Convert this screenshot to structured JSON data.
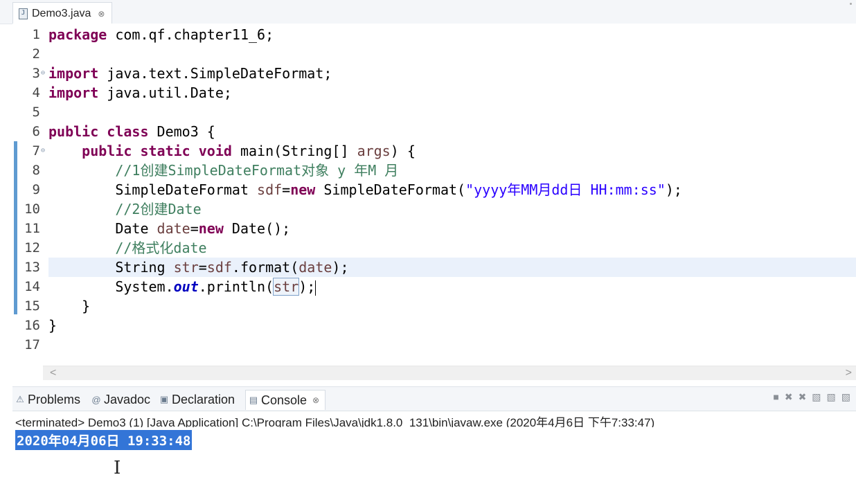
{
  "editor": {
    "tab_label": "Demo3.java",
    "tab_close": "⊗",
    "file_icon": "J",
    "lines": [
      {
        "n": "1",
        "fold": "",
        "tokens": [
          {
            "t": "package",
            "c": "kw"
          },
          {
            "t": " com.qf.chapter11_6;",
            "c": ""
          }
        ]
      },
      {
        "n": "2",
        "fold": "",
        "tokens": []
      },
      {
        "n": "3",
        "fold": "⊖",
        "tokens": [
          {
            "t": "import",
            "c": "kw"
          },
          {
            "t": " java.text.SimpleDateFormat;",
            "c": ""
          }
        ]
      },
      {
        "n": "4",
        "fold": "",
        "tokens": [
          {
            "t": "import",
            "c": "kw"
          },
          {
            "t": " java.util.Date;",
            "c": ""
          }
        ]
      },
      {
        "n": "5",
        "fold": "",
        "tokens": []
      },
      {
        "n": "6",
        "fold": "",
        "tokens": [
          {
            "t": "public",
            "c": "kw"
          },
          {
            "t": " ",
            "c": ""
          },
          {
            "t": "class",
            "c": "kw"
          },
          {
            "t": " Demo3 {",
            "c": ""
          }
        ]
      },
      {
        "n": "7",
        "fold": "⊖",
        "tokens": [
          {
            "t": "    ",
            "c": ""
          },
          {
            "t": "public",
            "c": "kw"
          },
          {
            "t": " ",
            "c": ""
          },
          {
            "t": "static",
            "c": "kw"
          },
          {
            "t": " ",
            "c": ""
          },
          {
            "t": "void",
            "c": "kw"
          },
          {
            "t": " main(String[] ",
            "c": ""
          },
          {
            "t": "args",
            "c": "var"
          },
          {
            "t": ") {",
            "c": ""
          }
        ]
      },
      {
        "n": "8",
        "fold": "",
        "tokens": [
          {
            "t": "        //1创建SimpleDateFormat对象 y 年M 月",
            "c": "cm"
          }
        ]
      },
      {
        "n": "9",
        "fold": "",
        "tokens": [
          {
            "t": "        SimpleDateFormat ",
            "c": ""
          },
          {
            "t": "sdf",
            "c": "var"
          },
          {
            "t": "=",
            "c": ""
          },
          {
            "t": "new",
            "c": "kw"
          },
          {
            "t": " SimpleDateFormat(",
            "c": ""
          },
          {
            "t": "\"yyyy年MM月dd日 HH:mm:ss\"",
            "c": "str"
          },
          {
            "t": ");",
            "c": ""
          }
        ]
      },
      {
        "n": "10",
        "fold": "",
        "tokens": [
          {
            "t": "        //2创建Date",
            "c": "cm"
          }
        ]
      },
      {
        "n": "11",
        "fold": "",
        "tokens": [
          {
            "t": "        Date ",
            "c": ""
          },
          {
            "t": "date",
            "c": "var"
          },
          {
            "t": "=",
            "c": ""
          },
          {
            "t": "new",
            "c": "kw"
          },
          {
            "t": " Date();",
            "c": ""
          }
        ]
      },
      {
        "n": "12",
        "fold": "",
        "tokens": [
          {
            "t": "        //格式化date",
            "c": "cm"
          }
        ]
      },
      {
        "n": "13",
        "fold": "",
        "current": true,
        "tokens": [
          {
            "t": "        String ",
            "c": ""
          },
          {
            "t": "str",
            "c": "var"
          },
          {
            "t": "=",
            "c": ""
          },
          {
            "t": "sdf",
            "c": "var"
          },
          {
            "t": ".format(",
            "c": ""
          },
          {
            "t": "date",
            "c": "var"
          },
          {
            "t": ");",
            "c": ""
          }
        ]
      },
      {
        "n": "14",
        "fold": "",
        "tokens": [
          {
            "t": "        System.",
            "c": ""
          },
          {
            "t": "out",
            "c": "fld"
          },
          {
            "t": ".println(",
            "c": ""
          },
          {
            "t": "str",
            "c": "var box"
          },
          {
            "t": ");",
            "c": ""
          },
          {
            "t": "",
            "c": "caret"
          }
        ]
      },
      {
        "n": "15",
        "fold": "",
        "tokens": [
          {
            "t": "    }",
            "c": ""
          }
        ]
      },
      {
        "n": "16",
        "fold": "",
        "tokens": [
          {
            "t": "}",
            "c": ""
          }
        ]
      },
      {
        "n": "17",
        "fold": "",
        "tokens": []
      }
    ],
    "scroll_left": "<",
    "scroll_right": ">"
  },
  "views": {
    "tabs": [
      {
        "label": "Problems",
        "icon": "⚠"
      },
      {
        "label": "Javadoc",
        "icon": "@"
      },
      {
        "label": "Declaration",
        "icon": "▣"
      },
      {
        "label": "Console",
        "icon": "▤"
      }
    ],
    "console_close": "⊗",
    "toolbar_icons": [
      "■",
      "✖",
      "✖",
      "▧",
      "▧",
      "▧"
    ]
  },
  "console": {
    "header": "<terminated> Demo3 (1) [Java Application] C:\\Program Files\\Java\\jdk1.8.0_131\\bin\\javaw.exe (2020年4月6日 下午7:33:47)",
    "output": "2020年04月06日 19:33:48",
    "cursor": "I"
  }
}
